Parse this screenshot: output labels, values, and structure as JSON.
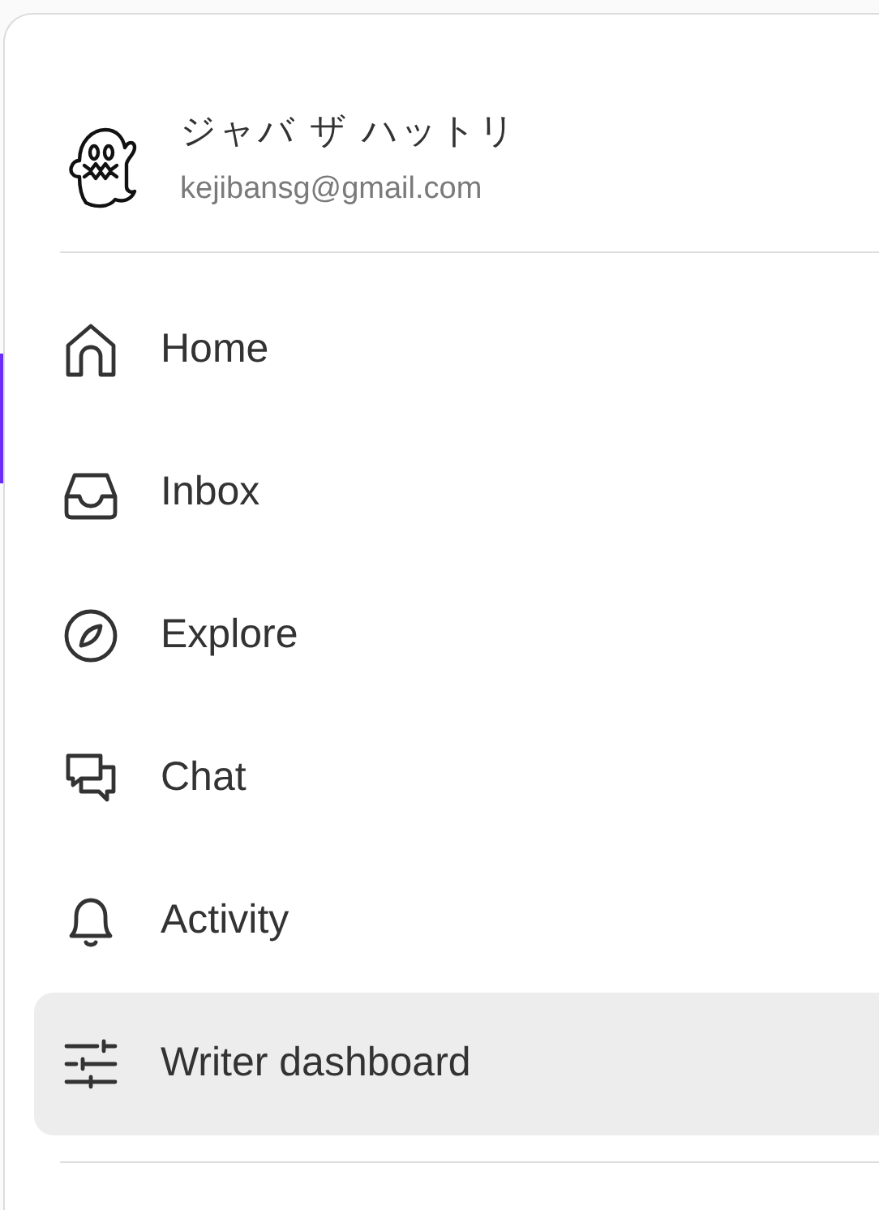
{
  "profile": {
    "name": "ジャバ ザ ハットリ",
    "email": "kejibansg@gmail.com"
  },
  "menu": {
    "items": [
      {
        "label": "Home",
        "selected": false
      },
      {
        "label": "Inbox",
        "selected": false
      },
      {
        "label": "Explore",
        "selected": false
      },
      {
        "label": "Chat",
        "selected": false
      },
      {
        "label": "Activity",
        "selected": false
      },
      {
        "label": "Writer dashboard",
        "selected": true
      }
    ]
  }
}
